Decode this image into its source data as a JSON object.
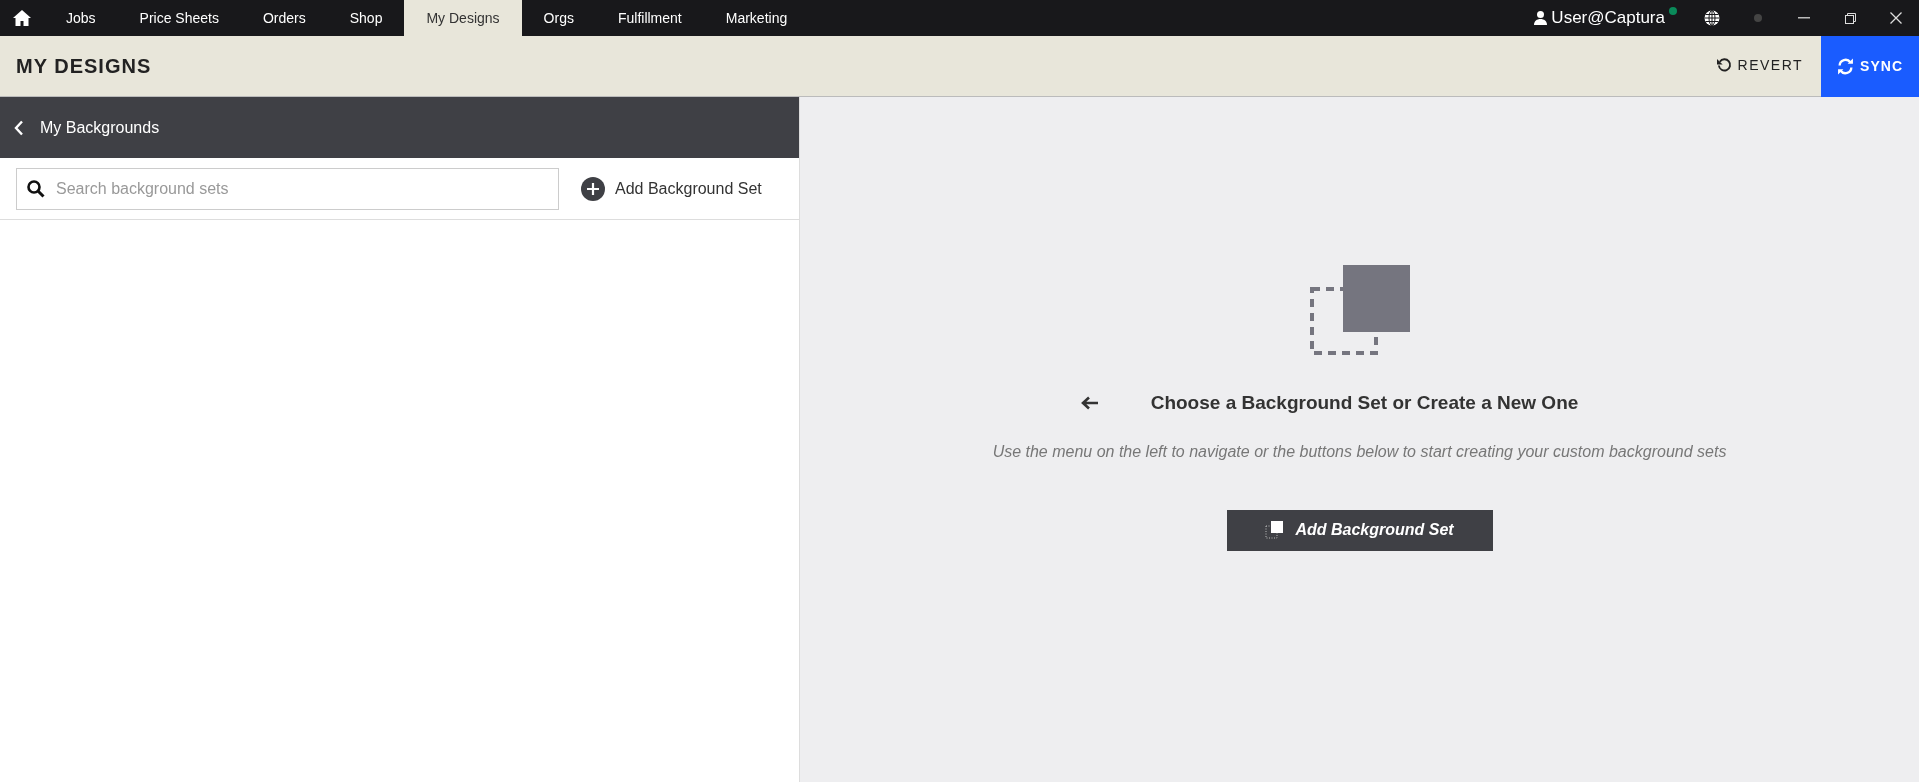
{
  "nav_tabs": [
    {
      "label": "Jobs",
      "selected": false
    },
    {
      "label": "Price Sheets",
      "selected": false
    },
    {
      "label": "Orders",
      "selected": false
    },
    {
      "label": "Shop",
      "selected": false
    },
    {
      "label": "My Designs",
      "selected": true
    },
    {
      "label": "Orgs",
      "selected": false
    },
    {
      "label": "Fulfillment",
      "selected": false
    },
    {
      "label": "Marketing",
      "selected": false
    }
  ],
  "user": "User@Captura",
  "page_title": "MY DESIGNS",
  "header_buttons": [
    {
      "label": "REVERT",
      "kind": "revert"
    },
    {
      "label": "SYNC",
      "kind": "sync"
    }
  ],
  "sidebar": {
    "title": "My Backgrounds",
    "search": {
      "placeholder": "Search background sets"
    },
    "add_button": "Add Background Set"
  },
  "empty_state": {
    "title": "Choose a Background Set or Create a New One",
    "subtitle": "Use the menu on the left to navigate or the buttons below to start creating your custom background sets",
    "button": "Add Background Set"
  }
}
